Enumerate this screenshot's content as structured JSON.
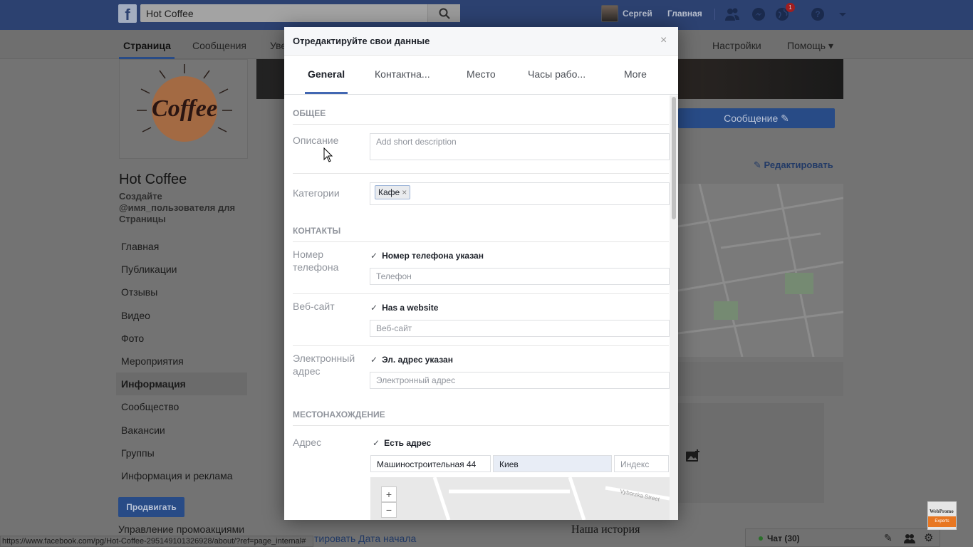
{
  "topbar": {
    "search_value": "Hot Coffee",
    "user_name": "Сергей",
    "home_label": "Главная",
    "notification_count": "1"
  },
  "page_nav": {
    "tabs": [
      "Страница",
      "Сообщения",
      "Уве",
      "Настройки",
      "Помощь ▾"
    ]
  },
  "page": {
    "name": "Hot Coffee",
    "username_prompt": "Создайте @имя_пользователя для Страницы",
    "logo_text": "Coffee",
    "sidebar_items": [
      "Главная",
      "Публикации",
      "Отзывы",
      "Видео",
      "Фото",
      "Мероприятия",
      "Информация",
      "Сообщество",
      "Вакансии",
      "Группы",
      "Информация и реклама"
    ],
    "active_item": "Информация",
    "promote_label": "Продвигать",
    "manage_promos": "Управление промоакциями",
    "message_button": "Сообщение",
    "edit_link": "Редактировать",
    "our_story": "Наша история",
    "bottom_link": "тировать Дата начала",
    "chat_label": "Чат (30)",
    "status_url": "https://www.facebook.com/pg/Hot-Coffee-295149101326928/about/?ref=page_internal#",
    "watermark_top": "WebPromo",
    "watermark_bottom": "Experts"
  },
  "modal": {
    "title": "Отредактируйте свои данные",
    "close": "×",
    "tabs": [
      "General",
      "Контактна...",
      "Место",
      "Часы рабо...",
      "More"
    ],
    "active_tab": "General",
    "sections": {
      "general": "ОБЩЕЕ",
      "contacts": "КОНТАКТЫ",
      "location": "МЕСТОНАХОЖДЕНИЕ"
    },
    "description": {
      "label": "Описание",
      "placeholder": "Add short description"
    },
    "categories": {
      "label": "Категории",
      "tag": "Кафе"
    },
    "phone": {
      "label": "Номер телефона",
      "checkbox": "Номер телефона указан",
      "placeholder": "Телефон"
    },
    "website": {
      "label": "Веб-сайт",
      "checkbox": "Has a website",
      "placeholder": "Веб-сайт"
    },
    "email": {
      "label": "Электронный адрес",
      "checkbox": "Эл. адрес указан",
      "placeholder": "Электронный адрес"
    },
    "address": {
      "label": "Адрес",
      "checkbox": "Есть адрес",
      "street": "Машиностроительная 44",
      "city": "Киев",
      "zip_placeholder": "Индекс"
    },
    "map_zoom_in": "+",
    "map_zoom_out": "−",
    "map_street": "Vyborzka Street"
  },
  "colors": {
    "fb_blue": "#4267b2",
    "header_dim": "#2c4170",
    "tag_border": "#9cb4d8"
  }
}
